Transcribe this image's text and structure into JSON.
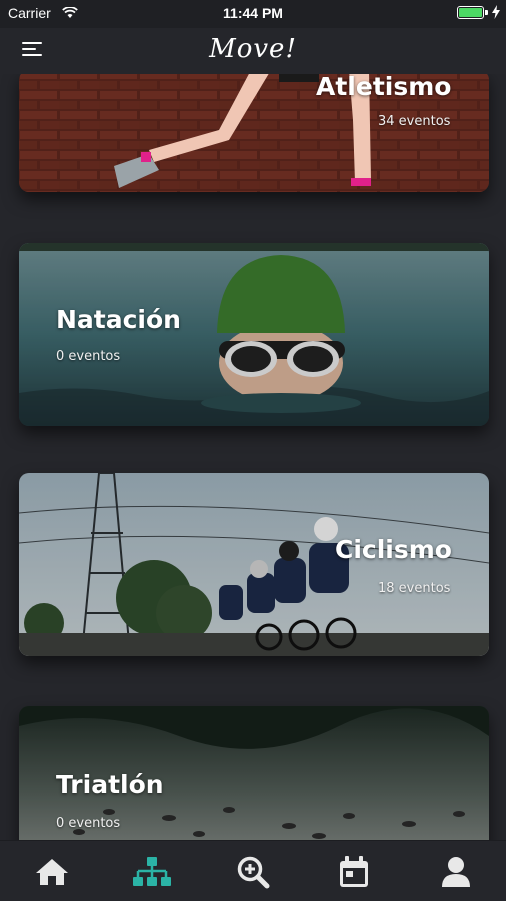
{
  "status_bar": {
    "carrier": "Carrier",
    "time": "11:44 PM"
  },
  "header": {
    "app_logo": "Move!"
  },
  "sports": [
    {
      "title": "Atletismo",
      "count": "34 eventos"
    },
    {
      "title": "Natación",
      "count": "0 eventos"
    },
    {
      "title": "Ciclismo",
      "count": "18 eventos"
    },
    {
      "title": "Triatlón",
      "count": "0 eventos"
    }
  ],
  "tab_bar": {
    "active_tab": "sports-hierarchy",
    "active_color": "#2bb3a6",
    "inactive_color": "#e8e8e8",
    "tabs": [
      "home-icon",
      "sitemap-icon",
      "search-zoom-icon",
      "calendar-icon",
      "user-icon"
    ]
  }
}
